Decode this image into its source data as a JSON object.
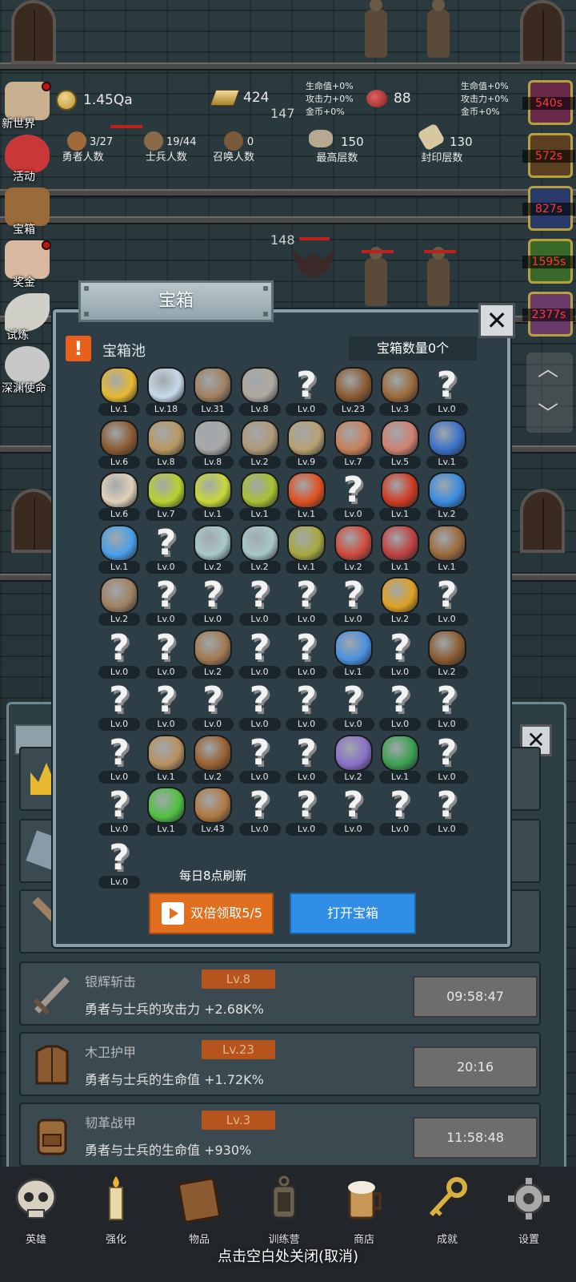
{
  "stats": {
    "gold": "1.45Qa",
    "bars": "424",
    "meat": "88",
    "floor_indicator_1": "147",
    "floor_indicator_2": "148",
    "buff_left": [
      "生命值+0%",
      "攻击力+0%",
      "金币+0%"
    ],
    "buff_right": [
      "生命值+0%",
      "攻击力+0%",
      "金币+0%"
    ],
    "hero_count": "3/27",
    "hero_label": "勇者人数",
    "soldier_count": "19/44",
    "soldier_label": "士兵人数",
    "summon_count": "0",
    "summon_label": "召唤人数",
    "max_floor": "150",
    "max_floor_label": "最高层数",
    "seal_floor": "130",
    "seal_floor_label": "封印层数"
  },
  "left_menu": [
    {
      "label": "新世界",
      "icon": "scroll-icon",
      "color": "#c9b090"
    },
    {
      "label": "活动",
      "icon": "heart-icon",
      "color": "#c83838"
    },
    {
      "label": "宝箱",
      "icon": "chest-icon",
      "color": "#9a6a3a"
    },
    {
      "label": "奖金",
      "icon": "envelope-icon",
      "color": "#d9b8a0"
    },
    {
      "label": "试炼",
      "icon": "feather-icon",
      "color": "#d0d0c8"
    },
    {
      "label": "深渊使命",
      "icon": "orb-icon",
      "color": "#c8c8c8"
    }
  ],
  "right_timers": [
    "540s",
    "572s",
    "827s",
    "1595s",
    "2377s"
  ],
  "modal": {
    "title": "宝箱",
    "pool_label": "宝箱池",
    "chest_count": "宝箱数量0个",
    "refresh_note": "每日8点刷新",
    "double_button": "双倍领取5/5",
    "open_button": "打开宝箱"
  },
  "items": [
    {
      "icon": "crown-icon",
      "lv": "Lv.1",
      "color": "#e8b830"
    },
    {
      "icon": "diamond-icon",
      "lv": "Lv.18",
      "color": "#c8d8e8"
    },
    {
      "icon": "sword-icon",
      "lv": "Lv.31",
      "color": "#a08060"
    },
    {
      "icon": "sword-icon",
      "lv": "Lv.8",
      "color": "#b0a8a0"
    },
    {
      "icon": "unknown-icon",
      "lv": "Lv.0"
    },
    {
      "icon": "armor-icon",
      "lv": "Lv.23",
      "color": "#8a5a30"
    },
    {
      "icon": "backpack-icon",
      "lv": "Lv.3",
      "color": "#9a6a3a"
    },
    {
      "icon": "unknown-icon",
      "lv": "Lv.0"
    },
    {
      "icon": "helmet-icon",
      "lv": "Lv.6",
      "color": "#8a5a30"
    },
    {
      "icon": "dagger-icon",
      "lv": "Lv.8",
      "color": "#b89860"
    },
    {
      "icon": "knight-helmet-icon",
      "lv": "Lv.8",
      "color": "#a8a8a8"
    },
    {
      "icon": "hammer-icon",
      "lv": "Lv.2",
      "color": "#b09878"
    },
    {
      "icon": "great-helm-icon",
      "lv": "Lv.9",
      "color": "#b8a070"
    },
    {
      "icon": "ham-icon",
      "lv": "Lv.7",
      "color": "#c8805a"
    },
    {
      "icon": "steak-icon",
      "lv": "Lv.5",
      "color": "#d08070"
    },
    {
      "icon": "pouch-icon",
      "lv": "Lv.1",
      "color": "#3a70c8"
    },
    {
      "icon": "flour-icon",
      "lv": "Lv.6",
      "color": "#e0d0b8"
    },
    {
      "icon": "potion-icon",
      "lv": "Lv.7",
      "color": "#b8d030"
    },
    {
      "icon": "potion-icon",
      "lv": "Lv.1",
      "color": "#c8d838"
    },
    {
      "icon": "potion-icon",
      "lv": "Lv.1",
      "color": "#a8c030"
    },
    {
      "icon": "potion-icon",
      "lv": "Lv.1",
      "color": "#e05020"
    },
    {
      "icon": "unknown-icon",
      "lv": "Lv.0"
    },
    {
      "icon": "potion-icon",
      "lv": "Lv.1",
      "color": "#d03a20"
    },
    {
      "icon": "potion-icon",
      "lv": "Lv.2",
      "color": "#3a8ae0"
    },
    {
      "icon": "potion-icon",
      "lv": "Lv.1",
      "color": "#4aa0e8"
    },
    {
      "icon": "unknown-icon",
      "lv": "Lv.0"
    },
    {
      "icon": "vial-icon",
      "lv": "Lv.2",
      "color": "#a8c8c8"
    },
    {
      "icon": "vial-icon",
      "lv": "Lv.2",
      "color": "#a8c8c8"
    },
    {
      "icon": "vial-icon",
      "lv": "Lv.1",
      "color": "#a8a840"
    },
    {
      "icon": "vial-icon",
      "lv": "Lv.2",
      "color": "#d04a3a"
    },
    {
      "icon": "winged-boot-icon",
      "lv": "Lv.1",
      "color": "#c04040"
    },
    {
      "icon": "boot-icon",
      "lv": "Lv.1",
      "color": "#9a6a3a"
    },
    {
      "icon": "boot-icon",
      "lv": "Lv.2",
      "color": "#a08060"
    },
    {
      "icon": "unknown-icon",
      "lv": "Lv.0"
    },
    {
      "icon": "unknown-icon",
      "lv": "Lv.0"
    },
    {
      "icon": "unknown-icon",
      "lv": "Lv.0"
    },
    {
      "icon": "unknown-icon",
      "lv": "Lv.0"
    },
    {
      "icon": "unknown-icon",
      "lv": "Lv.0"
    },
    {
      "icon": "torch-icon",
      "lv": "Lv.2",
      "color": "#e0a020"
    },
    {
      "icon": "unknown-icon",
      "lv": "Lv.0"
    },
    {
      "icon": "unknown-icon",
      "lv": "Lv.0"
    },
    {
      "icon": "unknown-icon",
      "lv": "Lv.0"
    },
    {
      "icon": "staff-icon",
      "lv": "Lv.2",
      "color": "#a07850"
    },
    {
      "icon": "unknown-icon",
      "lv": "Lv.0"
    },
    {
      "icon": "unknown-icon",
      "lv": "Lv.0"
    },
    {
      "icon": "wand-icon",
      "lv": "Lv.1",
      "color": "#4a90e0"
    },
    {
      "icon": "unknown-icon",
      "lv": "Lv.0"
    },
    {
      "icon": "backpack-icon",
      "lv": "Lv.2",
      "color": "#8a5a30"
    },
    {
      "icon": "unknown-icon",
      "lv": "Lv.0"
    },
    {
      "icon": "unknown-icon",
      "lv": "Lv.0"
    },
    {
      "icon": "unknown-icon",
      "lv": "Lv.0"
    },
    {
      "icon": "unknown-icon",
      "lv": "Lv.0"
    },
    {
      "icon": "unknown-icon",
      "lv": "Lv.0"
    },
    {
      "icon": "unknown-icon",
      "lv": "Lv.0"
    },
    {
      "icon": "unknown-icon",
      "lv": "Lv.0"
    },
    {
      "icon": "unknown-icon",
      "lv": "Lv.0"
    },
    {
      "icon": "unknown-icon",
      "lv": "Lv.0"
    },
    {
      "icon": "bow-icon",
      "lv": "Lv.1",
      "color": "#b89060"
    },
    {
      "icon": "quiver-icon",
      "lv": "Lv.2",
      "color": "#9a6030"
    },
    {
      "icon": "unknown-icon",
      "lv": "Lv.0"
    },
    {
      "icon": "unknown-icon",
      "lv": "Lv.0"
    },
    {
      "icon": "tentacle-icon",
      "lv": "Lv.2",
      "color": "#8a70c8"
    },
    {
      "icon": "emblem-icon",
      "lv": "Lv.1",
      "color": "#3aa050"
    },
    {
      "icon": "unknown-icon",
      "lv": "Lv.0"
    },
    {
      "icon": "unknown-icon",
      "lv": "Lv.0"
    },
    {
      "icon": "green-wand-icon",
      "lv": "Lv.1",
      "color": "#50c040"
    },
    {
      "icon": "beer-mug-icon",
      "lv": "Lv.43",
      "color": "#b07840"
    },
    {
      "icon": "unknown-icon",
      "lv": "Lv.0"
    },
    {
      "icon": "unknown-icon",
      "lv": "Lv.0"
    },
    {
      "icon": "unknown-icon",
      "lv": "Lv.0"
    },
    {
      "icon": "unknown-icon",
      "lv": "Lv.0"
    },
    {
      "icon": "unknown-icon",
      "lv": "Lv.0"
    },
    {
      "icon": "unknown-icon",
      "lv": "Lv.0"
    }
  ],
  "back_list": [
    {
      "name": "银辉斩击",
      "lv": "Lv.8",
      "desc": "勇者与士兵的攻击力 +2.68K%",
      "timer": "09:58:47",
      "icon": "sword-icon",
      "color": "#a09890"
    },
    {
      "name": "木卫护甲",
      "lv": "Lv.23",
      "desc": "勇者与士兵的生命值 +1.72K%",
      "timer": "20:16",
      "icon": "armor-icon",
      "color": "#8a5a30"
    },
    {
      "name": "韧革战甲",
      "lv": "Lv.3",
      "desc": "勇者与士兵的生命值 +930%",
      "timer": "11:58:48",
      "icon": "backpack-icon",
      "color": "#9a6a3a"
    }
  ],
  "bottom_nav": [
    {
      "label": "英雄",
      "icon": "skull-icon",
      "color": "#d8d0c0"
    },
    {
      "label": "强化",
      "icon": "candle-icon",
      "color": "#e8d8a8"
    },
    {
      "label": "物品",
      "icon": "book-icon",
      "color": "#8a5a30"
    },
    {
      "label": "训练营",
      "icon": "lantern-icon",
      "color": "#8a8070"
    },
    {
      "label": "商店",
      "icon": "mug-icon",
      "color": "#c89858"
    },
    {
      "label": "成就",
      "icon": "key-icon",
      "color": "#d8b040"
    },
    {
      "label": "设置",
      "icon": "gear-icon",
      "color": "#a8a8a8"
    }
  ],
  "close_hint": "点击空白处关闭(取消)"
}
